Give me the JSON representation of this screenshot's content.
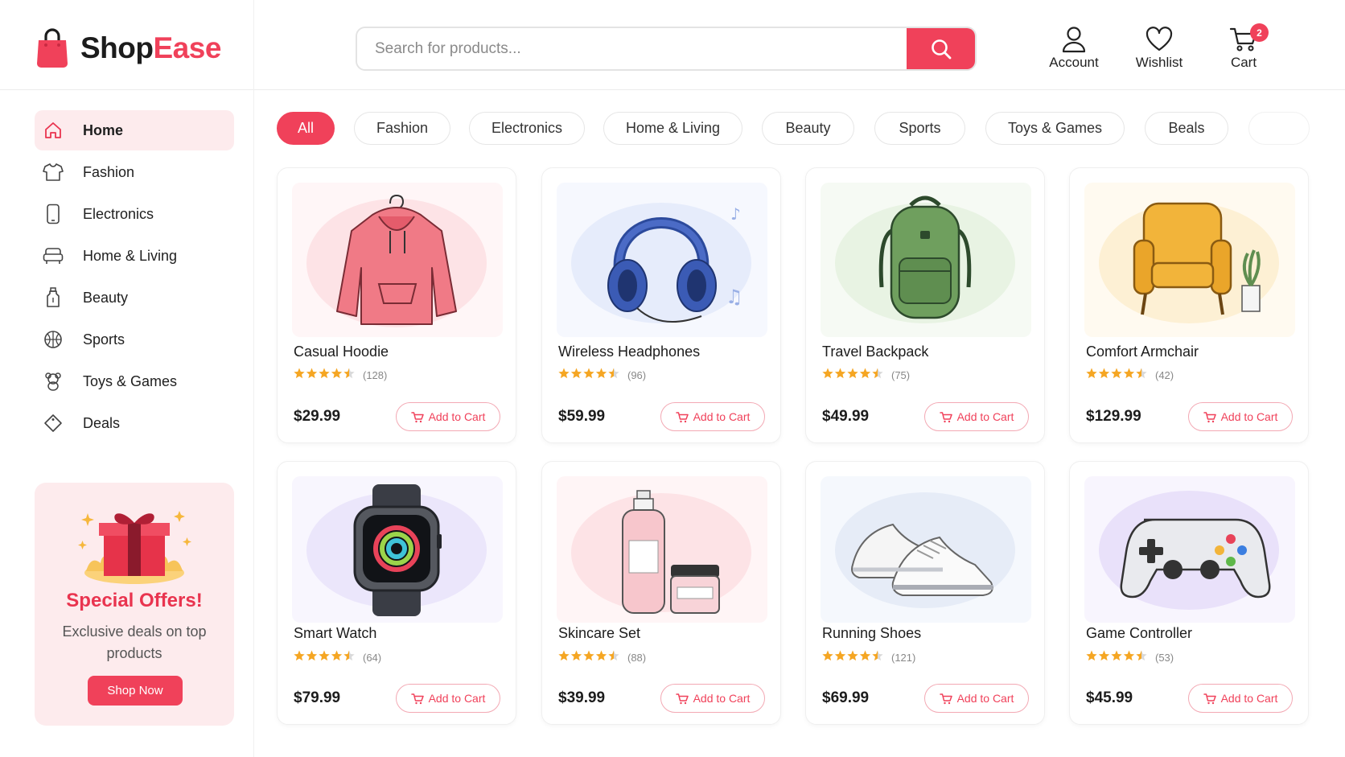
{
  "brand": {
    "name_part1": "Shop",
    "name_part2": "Ease",
    "accent": "#f0415a"
  },
  "search": {
    "placeholder": "Search for products...",
    "value": ""
  },
  "header_actions": {
    "account_label": "Account",
    "wishlist_label": "Wishlist",
    "cart_label": "Cart",
    "cart_count": "2"
  },
  "sidebar": {
    "items": [
      {
        "label": "Home",
        "icon": "home-icon",
        "active": true
      },
      {
        "label": "Fashion",
        "icon": "shirt-icon"
      },
      {
        "label": "Electronics",
        "icon": "phone-icon"
      },
      {
        "label": "Home & Living",
        "icon": "sofa-icon"
      },
      {
        "label": "Beauty",
        "icon": "bottle-icon"
      },
      {
        "label": "Sports",
        "icon": "ball-icon"
      },
      {
        "label": "Toys & Games",
        "icon": "teddy-icon"
      },
      {
        "label": "Deals",
        "icon": "tag-icon"
      }
    ],
    "promo": {
      "title": "Special Offers!",
      "description": "Exclusive deals on top products",
      "button": "Shop Now"
    }
  },
  "categories": [
    "All",
    "Fashion",
    "Electronics",
    "Home & Living",
    "Beauty",
    "Sports",
    "Toys & Games",
    "Beals"
  ],
  "products": [
    {
      "name": "Casual Hoodie",
      "rating": 4.5,
      "reviews": "(128)",
      "price": "$29.99",
      "button": "Add to Cart",
      "image": "hoodie"
    },
    {
      "name": "Wireless Headphones",
      "rating": 4.5,
      "reviews": "(96)",
      "price": "$59.99",
      "button": "Add to Cart",
      "image": "headphones"
    },
    {
      "name": "Travel Backpack",
      "rating": 4.5,
      "reviews": "(75)",
      "price": "$49.99",
      "button": "Add to Cart",
      "image": "backpack"
    },
    {
      "name": "Comfort Armchair",
      "rating": 4.5,
      "reviews": "(42)",
      "price": "$129.99",
      "button": "Add to Cart",
      "image": "armchair"
    },
    {
      "name": "Smart Watch",
      "rating": 4.5,
      "reviews": "(64)",
      "price": "$79.99",
      "button": "Add to Cart",
      "image": "smartwatch"
    },
    {
      "name": "Skincare Set",
      "rating": 4.5,
      "reviews": "(88)",
      "price": "$39.99",
      "button": "Add to Cart",
      "image": "skincare"
    },
    {
      "name": "Running Shoes",
      "rating": 4.5,
      "reviews": "(121)",
      "price": "$69.99",
      "button": "Add to Cart",
      "image": "sneakers"
    },
    {
      "name": "Game Controller",
      "rating": 4.5,
      "reviews": "(53)",
      "price": "$45.99",
      "button": "Add to Cart",
      "image": "gamepad"
    }
  ]
}
